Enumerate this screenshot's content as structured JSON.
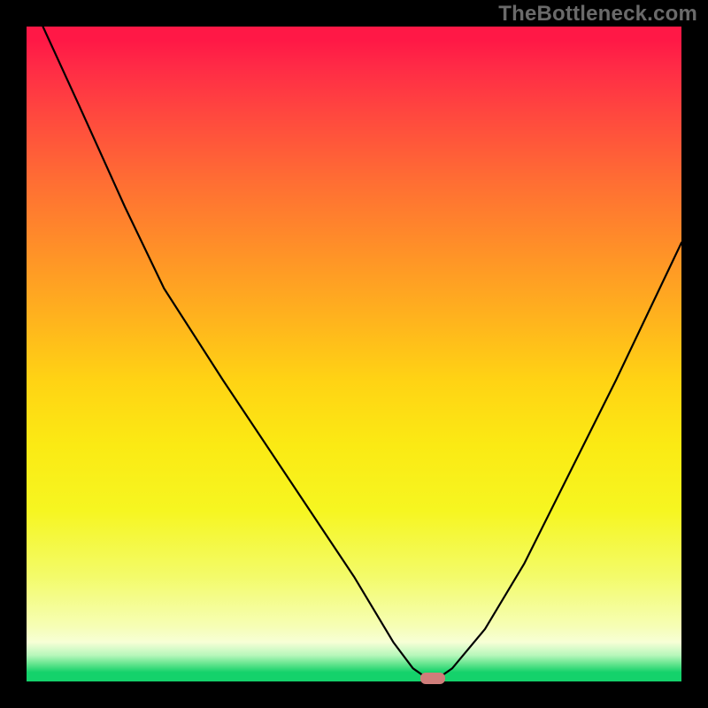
{
  "watermark": "TheBottleneck.com",
  "chart_data": {
    "type": "line",
    "title": "",
    "xlabel": "",
    "ylabel": "",
    "xlim": [
      0,
      100
    ],
    "ylim": [
      0,
      100
    ],
    "grid": false,
    "legend": false,
    "gradient_axis": "y",
    "gradient_meaning": "bottleneck percent (0 at bottom = balanced, 100 at top = severe)",
    "series": [
      {
        "name": "bottleneck-curve",
        "color": "#000000",
        "x": [
          2.5,
          8,
          15,
          21,
          30,
          40,
          50,
          56,
          59,
          61,
          63,
          65,
          70,
          76,
          82,
          90,
          100
        ],
        "y": [
          100,
          88,
          72.5,
          60,
          46,
          31,
          16,
          6,
          2,
          0.6,
          0.6,
          2,
          8,
          18,
          30,
          46,
          67
        ]
      }
    ],
    "marker": {
      "name": "optimal-point",
      "x": 62,
      "y": 0.6,
      "color": "#cf7d7a",
      "shape": "pill"
    }
  }
}
